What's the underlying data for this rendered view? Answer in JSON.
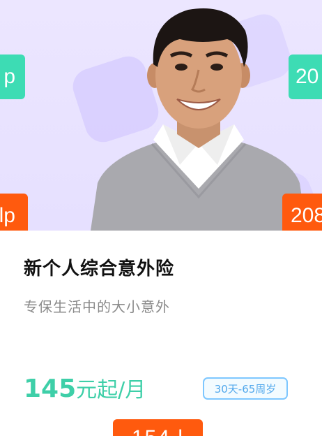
{
  "product": {
    "title": "新个人综合意外险",
    "subtitle": "专保生活中的大小意外",
    "price_value": "145",
    "price_unit": "元起/月",
    "age_range": "30天-65周岁"
  },
  "overlay_tags": {
    "top_left": "p",
    "top_right": "20",
    "mid_left": "lp",
    "mid_right": "208",
    "bottom_center": "154 l"
  },
  "colors": {
    "accent_green": "#3ddcb4",
    "accent_orange": "#ff5a0e",
    "age_border": "#7ec7ff"
  }
}
